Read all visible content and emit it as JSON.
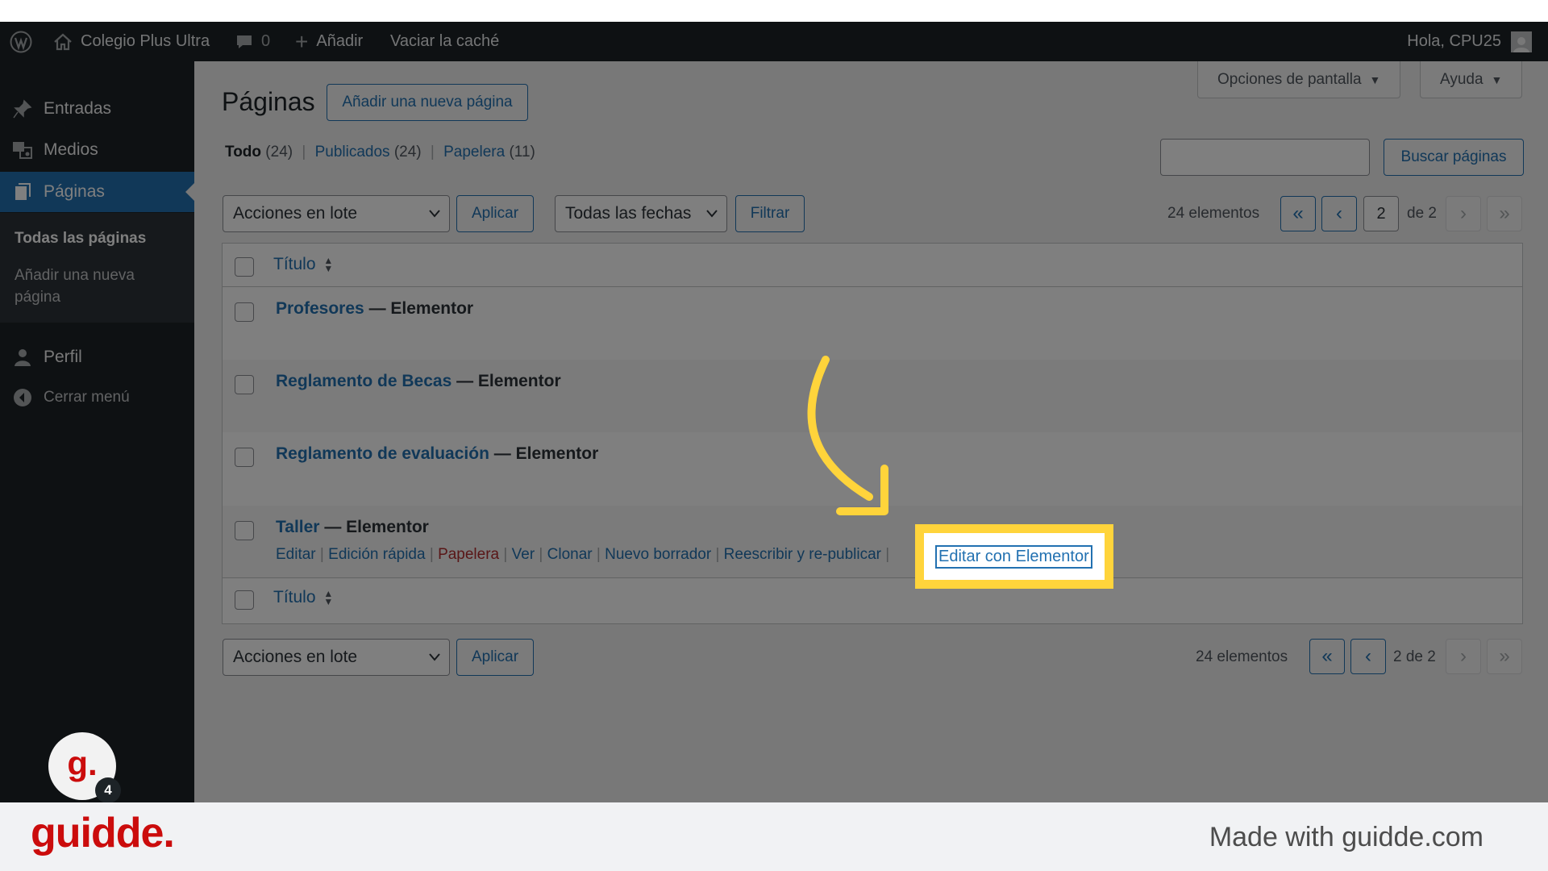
{
  "adminbar": {
    "site_name": "Colegio Plus Ultra",
    "comments_count": "0",
    "add_label": "Añadir",
    "cache_label": "Vaciar la caché",
    "greeting": "Hola, CPU25"
  },
  "sidebar": {
    "items": [
      {
        "label": "Entradas",
        "icon": "pin-icon"
      },
      {
        "label": "Medios",
        "icon": "media-icon"
      },
      {
        "label": "Páginas",
        "icon": "pages-icon"
      },
      {
        "label": "Perfil",
        "icon": "user-icon"
      },
      {
        "label": "Cerrar menú",
        "icon": "collapse-icon"
      }
    ],
    "submenu": {
      "current": "Todas las páginas",
      "add": "Añadir una nueva página"
    }
  },
  "header": {
    "title": "Páginas",
    "add_new": "Añadir una nueva página",
    "screen_options": "Opciones de pantalla",
    "help": "Ayuda"
  },
  "filters": {
    "all": "Todo",
    "all_count": "(24)",
    "published": "Publicados",
    "published_count": "(24)",
    "trash": "Papelera",
    "trash_count": "(11)"
  },
  "search": {
    "value": "",
    "button": "Buscar páginas"
  },
  "bulk": {
    "actions": "Acciones en lote",
    "apply": "Aplicar",
    "dates": "Todas las fechas",
    "filter": "Filtrar"
  },
  "pagination": {
    "count": "24 elementos",
    "first": "«",
    "prev": "‹",
    "current_page": "2",
    "of_total": "de 2",
    "bottom_label": "2 de 2",
    "next": "›",
    "last": "»"
  },
  "table": {
    "column_title": "Título",
    "rows": [
      {
        "title": "Profesores",
        "suffix": "— Elementor"
      },
      {
        "title": "Reglamento de Becas",
        "suffix": "— Elementor"
      },
      {
        "title": "Reglamento de evaluación",
        "suffix": "— Elementor"
      },
      {
        "title": "Taller",
        "suffix": "— Elementor"
      }
    ],
    "row_actions": {
      "edit": "Editar",
      "quick_edit": "Edición rápida",
      "trash": "Papelera",
      "view": "Ver",
      "clone": "Clonar",
      "new_draft": "Nuevo borrador",
      "rewrite": "Reescribir y re-publicar",
      "elementor": "Editar con Elementor"
    }
  },
  "guide": {
    "highlight_color": "#ffd43b",
    "brand": "guidde.",
    "made_with": "Made with guidde.com",
    "avatar_letter": "g.",
    "badge_count": "4"
  },
  "colors": {
    "admin_dark": "#1d2327",
    "wp_blue": "#2271b1",
    "trash_red": "#b32d2e",
    "guidde_red": "#cb0c0c"
  }
}
